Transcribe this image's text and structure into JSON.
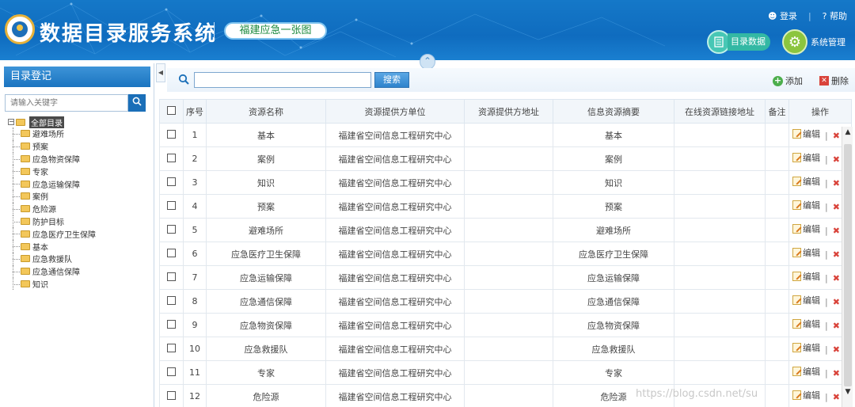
{
  "header": {
    "app_title": "数据目录服务系统",
    "subtitle_badge": "福建应急一张图",
    "login": "登录",
    "help": "帮助",
    "nav": [
      {
        "label": "目录数据",
        "icon": "catalog-icon"
      },
      {
        "label": "系统管理",
        "icon": "gear-icon"
      }
    ]
  },
  "sidebar": {
    "title": "目录登记",
    "search_placeholder": "请输入关键字",
    "tree_root": "全部目录",
    "tree_items": [
      "避难场所",
      "预案",
      "应急物资保障",
      "专家",
      "应急运输保障",
      "案例",
      "危险源",
      "防护目标",
      "应急医疗卫生保障",
      "基本",
      "应急救援队",
      "应急通信保障",
      "知识"
    ]
  },
  "toolbar": {
    "search_button": "搜索",
    "add": "添加",
    "delete": "删除"
  },
  "table": {
    "columns": [
      "序号",
      "资源名称",
      "资源提供方单位",
      "资源提供方地址",
      "信息资源摘要",
      "在线资源链接地址",
      "备注",
      "操作"
    ],
    "edit_label": "编辑",
    "delete_label": "删除",
    "rows": [
      {
        "no": "1",
        "name": "基本",
        "org": "福建省空间信息工程研究中心",
        "addr": "",
        "summary": "基本",
        "link": "",
        "remark": ""
      },
      {
        "no": "2",
        "name": "案例",
        "org": "福建省空间信息工程研究中心",
        "addr": "",
        "summary": "案例",
        "link": "",
        "remark": ""
      },
      {
        "no": "3",
        "name": "知识",
        "org": "福建省空间信息工程研究中心",
        "addr": "",
        "summary": "知识",
        "link": "",
        "remark": ""
      },
      {
        "no": "4",
        "name": "预案",
        "org": "福建省空间信息工程研究中心",
        "addr": "",
        "summary": "预案",
        "link": "",
        "remark": ""
      },
      {
        "no": "5",
        "name": "避难场所",
        "org": "福建省空间信息工程研究中心",
        "addr": "",
        "summary": "避难场所",
        "link": "",
        "remark": ""
      },
      {
        "no": "6",
        "name": "应急医疗卫生保障",
        "org": "福建省空间信息工程研究中心",
        "addr": "",
        "summary": "应急医疗卫生保障",
        "link": "",
        "remark": ""
      },
      {
        "no": "7",
        "name": "应急运输保障",
        "org": "福建省空间信息工程研究中心",
        "addr": "",
        "summary": "应急运输保障",
        "link": "",
        "remark": ""
      },
      {
        "no": "8",
        "name": "应急通信保障",
        "org": "福建省空间信息工程研究中心",
        "addr": "",
        "summary": "应急通信保障",
        "link": "",
        "remark": ""
      },
      {
        "no": "9",
        "name": "应急物资保障",
        "org": "福建省空间信息工程研究中心",
        "addr": "",
        "summary": "应急物资保障",
        "link": "",
        "remark": ""
      },
      {
        "no": "10",
        "name": "应急救援队",
        "org": "福建省空间信息工程研究中心",
        "addr": "",
        "summary": "应急救援队",
        "link": "",
        "remark": ""
      },
      {
        "no": "11",
        "name": "专家",
        "org": "福建省空间信息工程研究中心",
        "addr": "",
        "summary": "专家",
        "link": "",
        "remark": ""
      },
      {
        "no": "12",
        "name": "危险源",
        "org": "福建省空间信息工程研究中心",
        "addr": "",
        "summary": "危险源",
        "link": "",
        "remark": ""
      }
    ]
  },
  "watermark": "https://blog.csdn.net/su"
}
